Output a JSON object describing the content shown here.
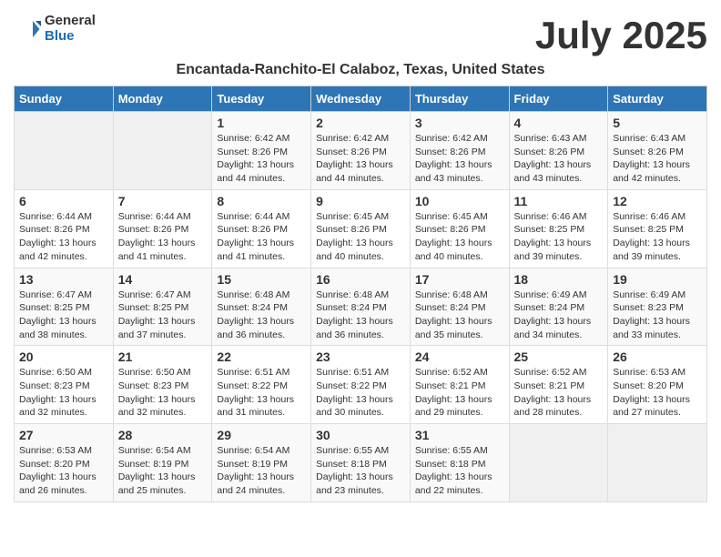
{
  "header": {
    "logo_general": "General",
    "logo_blue": "Blue",
    "month_title": "July 2025",
    "location": "Encantada-Ranchito-El Calaboz, Texas, United States"
  },
  "weekdays": [
    "Sunday",
    "Monday",
    "Tuesday",
    "Wednesday",
    "Thursday",
    "Friday",
    "Saturday"
  ],
  "weeks": [
    [
      {
        "day": "",
        "empty": true
      },
      {
        "day": "",
        "empty": true
      },
      {
        "day": "1",
        "sunrise": "Sunrise: 6:42 AM",
        "sunset": "Sunset: 8:26 PM",
        "daylight": "Daylight: 13 hours and 44 minutes."
      },
      {
        "day": "2",
        "sunrise": "Sunrise: 6:42 AM",
        "sunset": "Sunset: 8:26 PM",
        "daylight": "Daylight: 13 hours and 44 minutes."
      },
      {
        "day": "3",
        "sunrise": "Sunrise: 6:42 AM",
        "sunset": "Sunset: 8:26 PM",
        "daylight": "Daylight: 13 hours and 43 minutes."
      },
      {
        "day": "4",
        "sunrise": "Sunrise: 6:43 AM",
        "sunset": "Sunset: 8:26 PM",
        "daylight": "Daylight: 13 hours and 43 minutes."
      },
      {
        "day": "5",
        "sunrise": "Sunrise: 6:43 AM",
        "sunset": "Sunset: 8:26 PM",
        "daylight": "Daylight: 13 hours and 42 minutes."
      }
    ],
    [
      {
        "day": "6",
        "sunrise": "Sunrise: 6:44 AM",
        "sunset": "Sunset: 8:26 PM",
        "daylight": "Daylight: 13 hours and 42 minutes."
      },
      {
        "day": "7",
        "sunrise": "Sunrise: 6:44 AM",
        "sunset": "Sunset: 8:26 PM",
        "daylight": "Daylight: 13 hours and 41 minutes."
      },
      {
        "day": "8",
        "sunrise": "Sunrise: 6:44 AM",
        "sunset": "Sunset: 8:26 PM",
        "daylight": "Daylight: 13 hours and 41 minutes."
      },
      {
        "day": "9",
        "sunrise": "Sunrise: 6:45 AM",
        "sunset": "Sunset: 8:26 PM",
        "daylight": "Daylight: 13 hours and 40 minutes."
      },
      {
        "day": "10",
        "sunrise": "Sunrise: 6:45 AM",
        "sunset": "Sunset: 8:26 PM",
        "daylight": "Daylight: 13 hours and 40 minutes."
      },
      {
        "day": "11",
        "sunrise": "Sunrise: 6:46 AM",
        "sunset": "Sunset: 8:25 PM",
        "daylight": "Daylight: 13 hours and 39 minutes."
      },
      {
        "day": "12",
        "sunrise": "Sunrise: 6:46 AM",
        "sunset": "Sunset: 8:25 PM",
        "daylight": "Daylight: 13 hours and 39 minutes."
      }
    ],
    [
      {
        "day": "13",
        "sunrise": "Sunrise: 6:47 AM",
        "sunset": "Sunset: 8:25 PM",
        "daylight": "Daylight: 13 hours and 38 minutes."
      },
      {
        "day": "14",
        "sunrise": "Sunrise: 6:47 AM",
        "sunset": "Sunset: 8:25 PM",
        "daylight": "Daylight: 13 hours and 37 minutes."
      },
      {
        "day": "15",
        "sunrise": "Sunrise: 6:48 AM",
        "sunset": "Sunset: 8:24 PM",
        "daylight": "Daylight: 13 hours and 36 minutes."
      },
      {
        "day": "16",
        "sunrise": "Sunrise: 6:48 AM",
        "sunset": "Sunset: 8:24 PM",
        "daylight": "Daylight: 13 hours and 36 minutes."
      },
      {
        "day": "17",
        "sunrise": "Sunrise: 6:48 AM",
        "sunset": "Sunset: 8:24 PM",
        "daylight": "Daylight: 13 hours and 35 minutes."
      },
      {
        "day": "18",
        "sunrise": "Sunrise: 6:49 AM",
        "sunset": "Sunset: 8:24 PM",
        "daylight": "Daylight: 13 hours and 34 minutes."
      },
      {
        "day": "19",
        "sunrise": "Sunrise: 6:49 AM",
        "sunset": "Sunset: 8:23 PM",
        "daylight": "Daylight: 13 hours and 33 minutes."
      }
    ],
    [
      {
        "day": "20",
        "sunrise": "Sunrise: 6:50 AM",
        "sunset": "Sunset: 8:23 PM",
        "daylight": "Daylight: 13 hours and 32 minutes."
      },
      {
        "day": "21",
        "sunrise": "Sunrise: 6:50 AM",
        "sunset": "Sunset: 8:23 PM",
        "daylight": "Daylight: 13 hours and 32 minutes."
      },
      {
        "day": "22",
        "sunrise": "Sunrise: 6:51 AM",
        "sunset": "Sunset: 8:22 PM",
        "daylight": "Daylight: 13 hours and 31 minutes."
      },
      {
        "day": "23",
        "sunrise": "Sunrise: 6:51 AM",
        "sunset": "Sunset: 8:22 PM",
        "daylight": "Daylight: 13 hours and 30 minutes."
      },
      {
        "day": "24",
        "sunrise": "Sunrise: 6:52 AM",
        "sunset": "Sunset: 8:21 PM",
        "daylight": "Daylight: 13 hours and 29 minutes."
      },
      {
        "day": "25",
        "sunrise": "Sunrise: 6:52 AM",
        "sunset": "Sunset: 8:21 PM",
        "daylight": "Daylight: 13 hours and 28 minutes."
      },
      {
        "day": "26",
        "sunrise": "Sunrise: 6:53 AM",
        "sunset": "Sunset: 8:20 PM",
        "daylight": "Daylight: 13 hours and 27 minutes."
      }
    ],
    [
      {
        "day": "27",
        "sunrise": "Sunrise: 6:53 AM",
        "sunset": "Sunset: 8:20 PM",
        "daylight": "Daylight: 13 hours and 26 minutes."
      },
      {
        "day": "28",
        "sunrise": "Sunrise: 6:54 AM",
        "sunset": "Sunset: 8:19 PM",
        "daylight": "Daylight: 13 hours and 25 minutes."
      },
      {
        "day": "29",
        "sunrise": "Sunrise: 6:54 AM",
        "sunset": "Sunset: 8:19 PM",
        "daylight": "Daylight: 13 hours and 24 minutes."
      },
      {
        "day": "30",
        "sunrise": "Sunrise: 6:55 AM",
        "sunset": "Sunset: 8:18 PM",
        "daylight": "Daylight: 13 hours and 23 minutes."
      },
      {
        "day": "31",
        "sunrise": "Sunrise: 6:55 AM",
        "sunset": "Sunset: 8:18 PM",
        "daylight": "Daylight: 13 hours and 22 minutes."
      },
      {
        "day": "",
        "empty": true
      },
      {
        "day": "",
        "empty": true
      }
    ]
  ]
}
